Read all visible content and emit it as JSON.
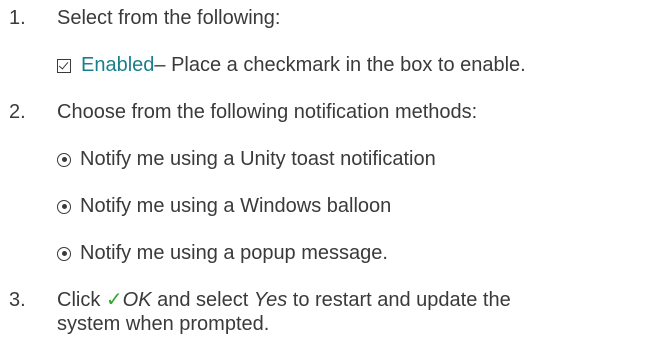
{
  "colors": {
    "text": "#3a3a3a",
    "link_accent": "#1a7f8c",
    "ok_check": "#2eaa2e"
  },
  "steps": [
    {
      "number": "1.",
      "text": "Select from the following:",
      "options": [
        {
          "icon": "checked-box-icon",
          "label": "Enabled",
          "description": " – Place a checkmark in the box to enable."
        }
      ]
    },
    {
      "number": "2.",
      "text": "Choose from the following notification methods:",
      "options": [
        {
          "icon": "radio-selected-icon",
          "label": "Notify me using a Unity toast notification"
        },
        {
          "icon": "radio-selected-icon",
          "label": "Notify me using a Windows balloon"
        },
        {
          "icon": "radio-selected-icon",
          "label": "Notify me using a popup message."
        }
      ]
    },
    {
      "number": "3.",
      "text_click": "Click ",
      "ok_glyph": "✓",
      "ok_label": "OK",
      "text_and": " and select ",
      "yes_label": "Yes",
      "text_rest_line1": " to restart and update the",
      "text_rest_line2": "system when prompted."
    }
  ]
}
